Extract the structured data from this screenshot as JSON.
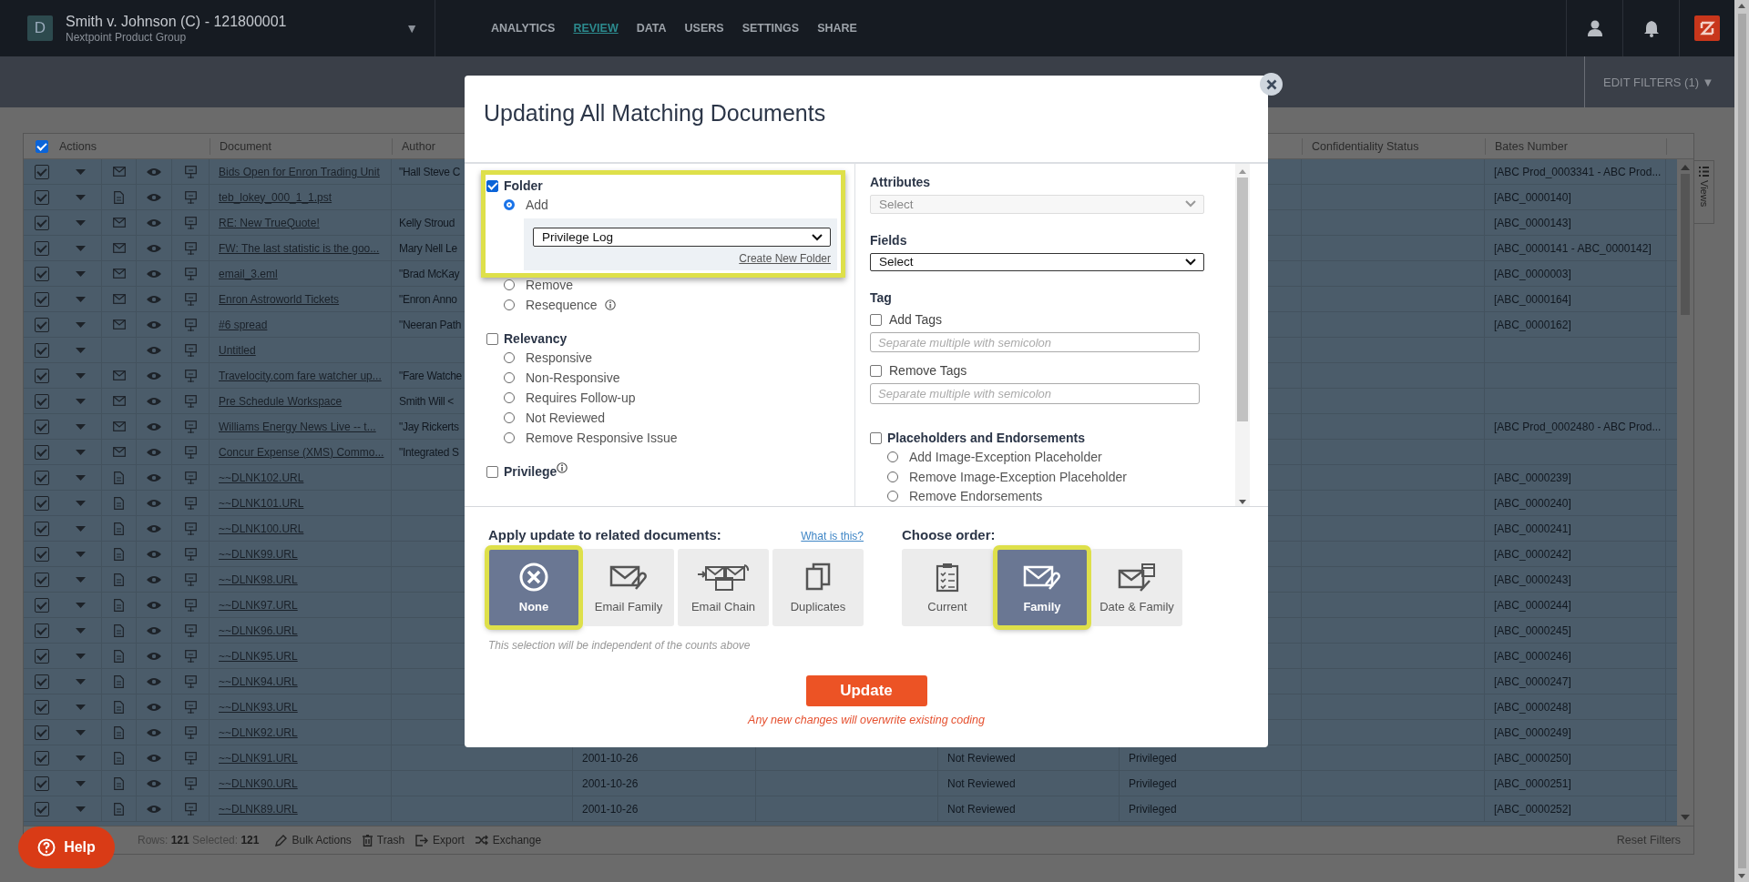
{
  "header": {
    "avatar_letter": "D",
    "case_title": "Smith v. Johnson (C) - 121800001",
    "organization": "Nextpoint Product Group",
    "dropdown_glyph": "▼"
  },
  "nav": [
    {
      "label": "ANALYTICS",
      "selected": false
    },
    {
      "label": "REVIEW",
      "selected": true
    },
    {
      "label": "DATA",
      "selected": false
    },
    {
      "label": "USERS",
      "selected": false
    },
    {
      "label": "SETTINGS",
      "selected": false
    },
    {
      "label": "SHARE",
      "selected": false
    }
  ],
  "filter_bar": {
    "edit_filters": "EDIT FILTERS (1) ▼"
  },
  "table": {
    "all_checked": true,
    "columns": [
      "Actions",
      "Document",
      "Author",
      "Confidentiality Status",
      "Bates Number"
    ],
    "views_tab": "Views",
    "rows": [
      {
        "checked": true,
        "kind": "email",
        "document": "Bids Open for Enron Trading Unit",
        "author": "\"Hall Steve C",
        "bates": "[ABC Prod_0003341 - ABC Prod..."
      },
      {
        "checked": true,
        "kind": "file",
        "document": "teb_lokey_000_1_1.pst",
        "bates": "[ABC_0000140]"
      },
      {
        "checked": true,
        "kind": "email",
        "document": "RE: New TrueQuote!",
        "author": "Kelly Stroud",
        "bates": "[ABC_0000143]"
      },
      {
        "checked": true,
        "kind": "email",
        "document": "FW: The last statistic is the goo...",
        "author": "Mary Nell Le",
        "bates": "[ABC_0000141 - ABC_0000142]"
      },
      {
        "checked": true,
        "kind": "email",
        "document": "email_3.eml",
        "author": "\"Brad McKay",
        "bates": "[ABC_0000003]"
      },
      {
        "checked": true,
        "kind": "email",
        "document": "Enron Astroworld Tickets",
        "author": "\"Enron Anno",
        "bates": "[ABC_0000164]"
      },
      {
        "checked": true,
        "kind": "email",
        "document": "#6 spread",
        "author": "\"Neeran Path",
        "bates": "[ABC_0000162]"
      },
      {
        "checked": true,
        "kind": "none",
        "document": "Untitled"
      },
      {
        "checked": true,
        "kind": "email",
        "document": "Travelocity.com fare watcher up...",
        "author": "\"Fare Watche"
      },
      {
        "checked": true,
        "kind": "email",
        "document": "Pre Schedule Workspace",
        "author": "Smith Will <"
      },
      {
        "checked": true,
        "kind": "email",
        "document": "Williams Energy News Live -- t...",
        "author": "\"Jay Rickerts",
        "bates": "[ABC Prod_0002480 - ABC Prod..."
      },
      {
        "checked": true,
        "kind": "email",
        "document": "Concur Expense (XMS) Commo...",
        "author": "\"Integrated S"
      },
      {
        "checked": true,
        "kind": "file",
        "document": "~~DLNK102.URL",
        "bates": "[ABC_0000239]"
      },
      {
        "checked": true,
        "kind": "file",
        "document": "~~DLNK101.URL",
        "bates": "[ABC_0000240]"
      },
      {
        "checked": true,
        "kind": "file",
        "document": "~~DLNK100.URL",
        "bates": "[ABC_0000241]"
      },
      {
        "checked": true,
        "kind": "file",
        "document": "~~DLNK99.URL",
        "bates": "[ABC_0000242]"
      },
      {
        "checked": true,
        "kind": "file",
        "document": "~~DLNK98.URL",
        "bates": "[ABC_0000243]"
      },
      {
        "checked": true,
        "kind": "file",
        "document": "~~DLNK97.URL",
        "bates": "[ABC_0000244]"
      },
      {
        "checked": true,
        "kind": "file",
        "document": "~~DLNK96.URL",
        "bates": "[ABC_0000245]"
      },
      {
        "checked": true,
        "kind": "file",
        "document": "~~DLNK95.URL",
        "bates": "[ABC_0000246]"
      },
      {
        "checked": true,
        "kind": "file",
        "document": "~~DLNK94.URL",
        "bates": "[ABC_0000247]"
      },
      {
        "checked": true,
        "kind": "file",
        "document": "~~DLNK93.URL",
        "bates": "[ABC_0000248]"
      },
      {
        "checked": true,
        "kind": "file",
        "document": "~~DLNK92.URL",
        "bates": "[ABC_0000249]"
      },
      {
        "checked": true,
        "kind": "file",
        "document": "~~DLNK91.URL",
        "date": "2001-10-26",
        "review_status": "Not Reviewed",
        "privilege": "Privileged",
        "bates": "[ABC_0000250]"
      },
      {
        "checked": true,
        "kind": "file",
        "document": "~~DLNK90.URL",
        "date": "2001-10-26",
        "review_status": "Not Reviewed",
        "privilege": "Privileged",
        "bates": "[ABC_0000251]"
      },
      {
        "checked": true,
        "kind": "file",
        "document": "~~DLNK89.URL",
        "date": "2001-10-26",
        "review_status": "Not Reviewed",
        "privilege": "Privileged",
        "bates": "[ABC_0000252]"
      }
    ]
  },
  "footer": {
    "rows_label": "Rows:",
    "rows": "121",
    "selected_label": "Selected:",
    "selected": "121",
    "actions": [
      {
        "kind": "bulk",
        "label": "Bulk Actions"
      },
      {
        "kind": "trash",
        "label": "Trash"
      },
      {
        "kind": "export",
        "label": "Export"
      },
      {
        "kind": "exchange",
        "label": "Exchange"
      }
    ],
    "reset": "Reset Filters"
  },
  "help": "Help",
  "modal": {
    "title": "Updating All Matching Documents",
    "folder": {
      "label": "Folder",
      "checked": true,
      "highlighted": true,
      "options": [
        {
          "label": "Add",
          "selected": true
        },
        {
          "label": "Remove",
          "selected": false
        },
        {
          "label": "Resequence",
          "selected": false,
          "info": true
        }
      ],
      "folder_value": "Privilege Log",
      "create_link": "Create New Folder"
    },
    "relevancy": {
      "label": "Relevancy",
      "checked": false,
      "options": [
        {
          "label": "Responsive",
          "selected": false
        },
        {
          "label": "Non-Responsive",
          "selected": false
        },
        {
          "label": "Requires Follow-up",
          "selected": false
        },
        {
          "label": "Not Reviewed",
          "selected": false
        },
        {
          "label": "Remove Responsive Issue",
          "selected": false
        }
      ]
    },
    "privilege": {
      "label": "Privilege",
      "checked": false,
      "info": true
    },
    "attributes": {
      "label": "Attributes",
      "value": "Select",
      "disabled": true
    },
    "fields": {
      "label": "Fields",
      "value": "Select",
      "disabled": false
    },
    "tag": {
      "label": "Tag",
      "items": [
        {
          "label": "Add Tags",
          "checked": false,
          "placeholder": "Separate multiple with semicolon"
        },
        {
          "label": "Remove Tags",
          "checked": false,
          "placeholder": "Separate multiple with semicolon"
        }
      ]
    },
    "placeholders": {
      "label": "Placeholders and Endorsements",
      "checked": false,
      "options": [
        {
          "label": "Add Image-Exception Placeholder",
          "selected": false
        },
        {
          "label": "Remove Image-Exception Placeholder",
          "selected": false
        },
        {
          "label": "Remove Endorsements",
          "selected": false
        }
      ]
    },
    "apply": {
      "title": "Apply update to related documents:",
      "link": "What is this?",
      "note": "This selection will be independent of the counts above",
      "options": [
        {
          "kind": "none",
          "label": "None",
          "selected": true
        },
        {
          "kind": "email_family",
          "label": "Email Family",
          "selected": false
        },
        {
          "kind": "email_chain",
          "label": "Email Chain",
          "selected": false
        },
        {
          "kind": "duplicates",
          "label": "Duplicates",
          "selected": false
        }
      ]
    },
    "order": {
      "title": "Choose order:",
      "options": [
        {
          "kind": "current",
          "label": "Current",
          "selected": false
        },
        {
          "kind": "family",
          "label": "Family",
          "selected": true
        },
        {
          "kind": "date_family",
          "label": "Date & Family",
          "selected": false
        }
      ]
    },
    "update_button": "Update",
    "warning": "Any new changes will overwrite existing coding"
  }
}
